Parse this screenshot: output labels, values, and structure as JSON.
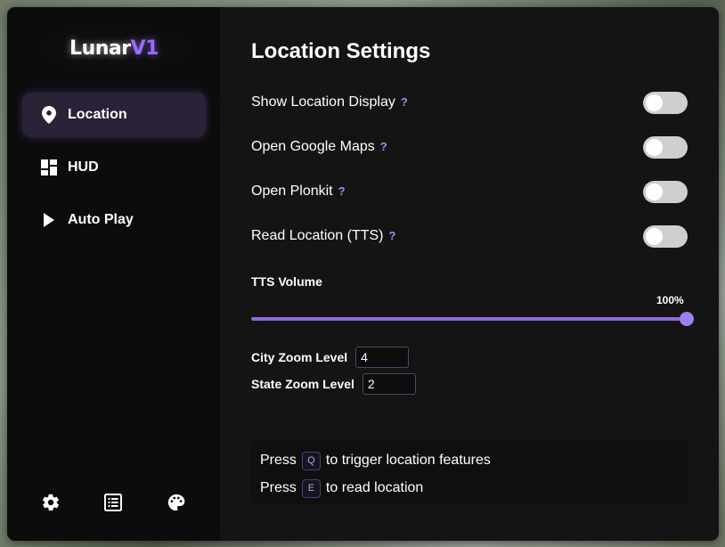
{
  "logo": {
    "part1": "Lunar",
    "part2": "V1"
  },
  "sidebar": {
    "items": [
      {
        "label": "Location",
        "icon": "location-pin-icon",
        "active": true
      },
      {
        "label": "HUD",
        "icon": "dashboard-icon",
        "active": false
      },
      {
        "label": "Auto Play",
        "icon": "play-icon",
        "active": false
      }
    ],
    "bottom_icons": [
      "gear-icon",
      "list-icon",
      "palette-icon"
    ]
  },
  "main": {
    "title": "Location Settings",
    "settings": [
      {
        "label": "Show Location Display",
        "help": "?",
        "enabled": false
      },
      {
        "label": "Open Google Maps",
        "help": "?",
        "enabled": false
      },
      {
        "label": "Open Plonkit",
        "help": "?",
        "enabled": false
      },
      {
        "label": "Read Location (TTS)",
        "help": "?",
        "enabled": false
      }
    ],
    "tts_volume": {
      "label": "TTS Volume",
      "value_text": "100%",
      "value": 100
    },
    "city_zoom": {
      "label": "City Zoom Level",
      "value": "4"
    },
    "state_zoom": {
      "label": "State Zoom Level",
      "value": "2"
    },
    "hints": [
      {
        "prefix": "Press",
        "key": "Q",
        "suffix": "to trigger location features"
      },
      {
        "prefix": "Press",
        "key": "E",
        "suffix": "to read location"
      }
    ]
  },
  "colors": {
    "accent": "#9b6bff",
    "window_bg": "#141414",
    "sidebar_bg": "#0c0c0c",
    "toggle_off": "#cfcfcf"
  }
}
